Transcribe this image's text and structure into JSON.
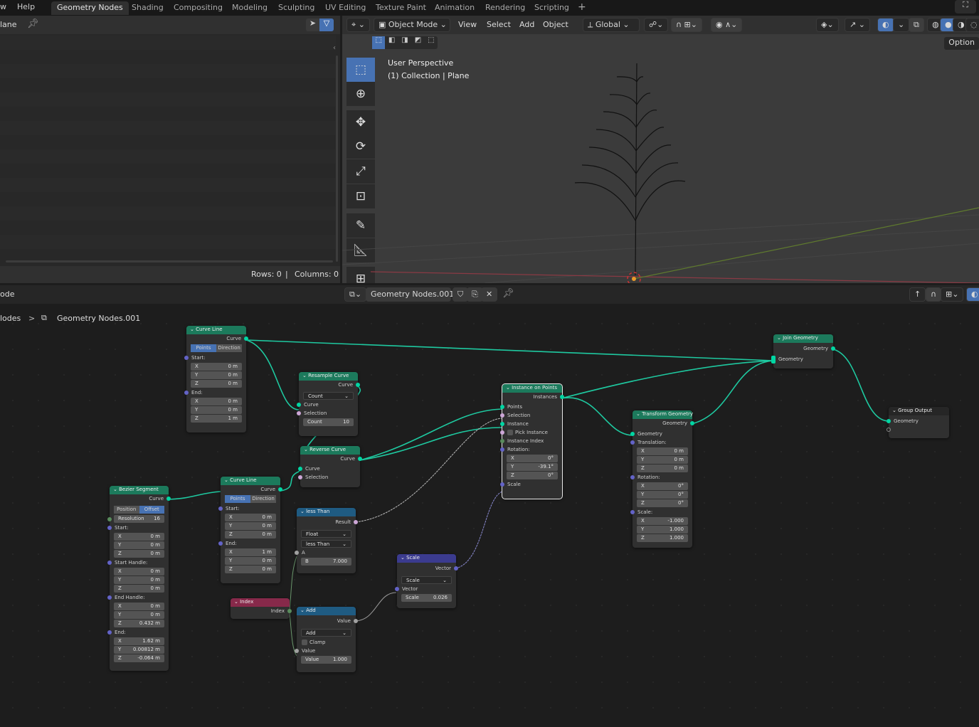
{
  "topbar": {
    "menus": [
      "w",
      "Help"
    ],
    "workspaces": [
      "Geometry Nodes",
      "Shading",
      "Compositing",
      "Modeling",
      "Sculpting",
      "UV Editing",
      "Texture Paint",
      "Animation",
      "Rendering",
      "Scripting"
    ],
    "active_workspace": "Geometry Nodes",
    "add_tab": "+"
  },
  "spreadsheet": {
    "object_label": "lane",
    "rows": "Rows: 0",
    "separator": "|",
    "columns": "Columns: 0"
  },
  "viewport": {
    "mode": "Object Mode",
    "menus": [
      "View",
      "Select",
      "Add",
      "Object"
    ],
    "orientation": "Global",
    "options_label": "Option",
    "overlay_line1": "User Perspective",
    "overlay_line2": "(1) Collection | Plane"
  },
  "node_editor": {
    "editor_label": "ode",
    "tree_name": "Geometry Nodes.001",
    "breadcrumb_parent": "lodes",
    "breadcrumb_sep": ">",
    "breadcrumb_current": "Geometry Nodes.001"
  },
  "nodes": {
    "curve_line1": {
      "title": "Curve Line",
      "out": "Curve",
      "modes": [
        "Points",
        "Direction"
      ],
      "start": "Start:",
      "end": "End:",
      "start_vals": [
        "0 m",
        "0 m",
        "0 m"
      ],
      "end_vals": [
        "0 m",
        "0 m",
        "1 m"
      ]
    },
    "resample": {
      "title": "Resample Curve",
      "out": "Curve",
      "mode": "Count",
      "in_curve": "Curve",
      "selection": "Selection",
      "count_label": "Count",
      "count": "10"
    },
    "reverse": {
      "title": "Reverse Curve",
      "out": "Curve",
      "in_curve": "Curve",
      "selection": "Selection"
    },
    "iop": {
      "title": "Instance on Points",
      "out": "Instances",
      "points": "Points",
      "selection": "Selection",
      "instance": "Instance",
      "pick": "Pick Instance",
      "index": "Instance Index",
      "rotation": "Rotation:",
      "rot_vals": [
        "0°",
        "-39.1°",
        "0°"
      ],
      "scale": "Scale"
    },
    "transform": {
      "title": "Transform Geometry",
      "out": "Geometry",
      "in": "Geometry",
      "translation": "Translation:",
      "t_vals": [
        "0 m",
        "0 m",
        "0 m"
      ],
      "rotation": "Rotation:",
      "r_vals": [
        "0°",
        "0°",
        "0°"
      ],
      "scale": "Scale:",
      "s_vals": [
        "-1.000",
        "1.000",
        "1.000"
      ]
    },
    "join": {
      "title": "Join Geometry",
      "out": "Geometry",
      "in": "Geometry"
    },
    "group_output": {
      "title": "Group Output",
      "in": "Geometry"
    },
    "bezier": {
      "title": "Bezier Segment",
      "out": "Curve",
      "modes": [
        "Position",
        "Offset"
      ],
      "res_label": "Resolution",
      "res": "16",
      "start": "Start:",
      "start_vals": [
        "0 m",
        "0 m",
        "0 m"
      ],
      "sh": "Start Handle:",
      "sh_vals": [
        "0 m",
        "0 m",
        "0 m"
      ],
      "eh": "End Handle:",
      "eh_vals": [
        "0 m",
        "0 m",
        "0.432 m"
      ],
      "end": "End:",
      "end_vals": [
        "1.62 m",
        "0.00812 m",
        "-0.064 m"
      ]
    },
    "curve_line2": {
      "title": "Curve Line",
      "out": "Curve",
      "modes": [
        "Points",
        "Direction"
      ],
      "start": "Start:",
      "end": "End:",
      "start_vals": [
        "0 m",
        "0 m",
        "0 m"
      ],
      "end_vals": [
        "1 m",
        "0 m",
        "0 m"
      ]
    },
    "less_than": {
      "title": "less Than",
      "out": "Result",
      "type": "Float",
      "op": "less Than",
      "a": "A",
      "b_label": "B",
      "b": "7.000"
    },
    "index": {
      "title": "Index",
      "out": "Index"
    },
    "add": {
      "title": "Add",
      "out": "Value",
      "op": "Add",
      "clamp": "Clamp",
      "in": "Value",
      "val_label": "Value",
      "val": "1.000"
    },
    "scale": {
      "title": "Scale",
      "out": "Vector",
      "op": "Scale",
      "in": "Vector",
      "s_label": "Scale",
      "s": "0.026"
    }
  },
  "axes": [
    "X",
    "Y",
    "Z"
  ]
}
